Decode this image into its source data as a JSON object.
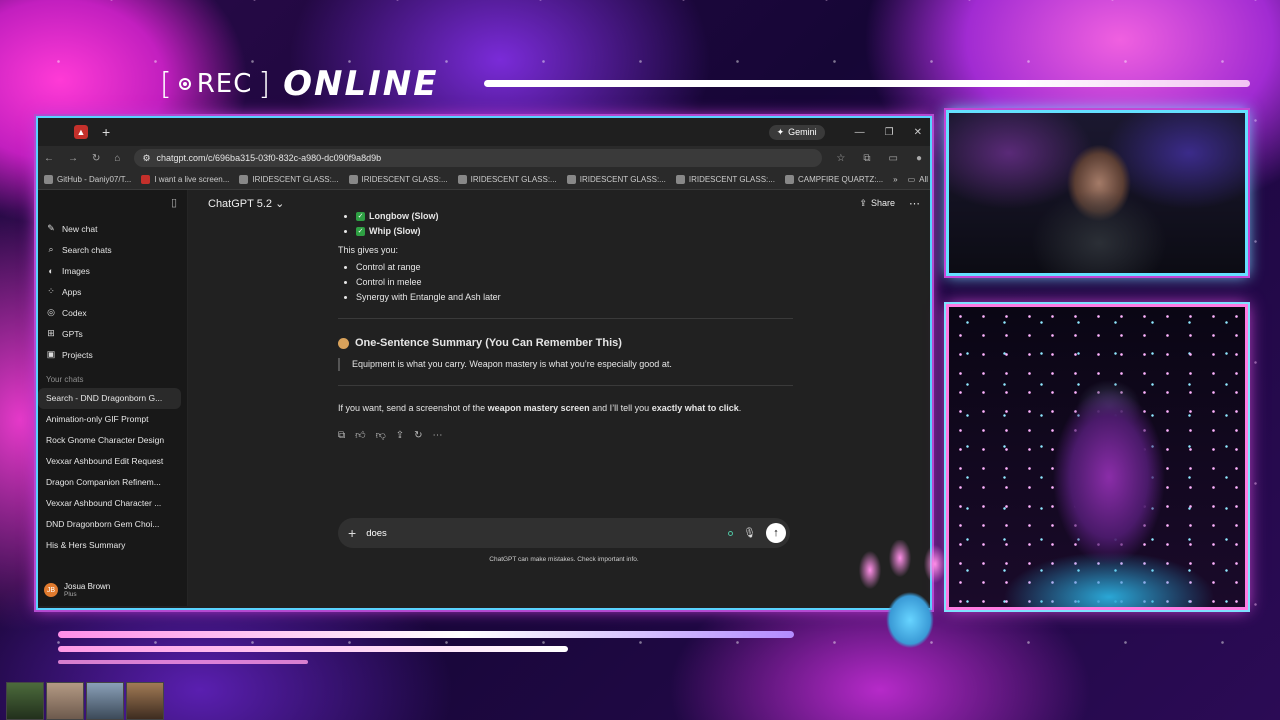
{
  "overlay": {
    "rec_label": "REC",
    "online_label": "ONLINE"
  },
  "browser": {
    "gemini_label": "Gemini",
    "url": "chatgpt.com/c/696ba315-03f0-832c-a980-dc090f9a8d9b",
    "bookmarks": [
      "GitHub - Daniy07/T...",
      "I want a live screen...",
      "IRIDESCENT GLASS:...",
      "IRIDESCENT GLASS:...",
      "IRIDESCENT GLASS:...",
      "IRIDESCENT GLASS:...",
      "IRIDESCENT GLASS:...",
      "CAMPFIRE QUARTZ:...",
      "All Bookmarks"
    ]
  },
  "sidebar": {
    "items": [
      {
        "label": "New chat",
        "icon": "edit-icon"
      },
      {
        "label": "Search chats",
        "icon": "search-icon"
      },
      {
        "label": "Images",
        "icon": "image-icon"
      },
      {
        "label": "Apps",
        "icon": "apps-icon"
      },
      {
        "label": "Codex",
        "icon": "codex-icon"
      },
      {
        "label": "GPTs",
        "icon": "gpts-icon"
      },
      {
        "label": "Projects",
        "icon": "folder-icon"
      }
    ],
    "section_label": "Your chats",
    "chats": [
      "Search - DND Dragonborn G...",
      "Animation-only GIF Prompt",
      "Rock Gnome Character Design",
      "Vexxar Ashbound Edit Request",
      "Dragon Companion Refinem...",
      "Vexxar Ashbound Character ...",
      "DND Dragonborn Gem Choi...",
      "His & Hers Summary"
    ],
    "user": {
      "initials": "JB",
      "name": "Josua Brown",
      "plan": "Plus"
    }
  },
  "main": {
    "model": "ChatGPT 5.2",
    "share_label": "Share",
    "list_top": [
      {
        "label": "Longbow (Slow)"
      },
      {
        "label": "Whip (Slow)"
      }
    ],
    "gives_you": "This gives you:",
    "benefits": [
      "Control at range",
      "Control in melee",
      "Synergy with Entangle and Ash later"
    ],
    "summary_heading": "One-Sentence Summary (You Can Remember This)",
    "summary_quote": "Equipment is what you carry. Weapon mastery is what you’re especially good at.",
    "closing": {
      "p1": "If you want, send a screenshot of the ",
      "b1": "weapon mastery screen",
      "p2": " and I’ll tell you ",
      "b2": "exactly what to click",
      "p3": "."
    },
    "input_value": "does",
    "disclaimer": "ChatGPT can make mistakes. Check important info."
  }
}
